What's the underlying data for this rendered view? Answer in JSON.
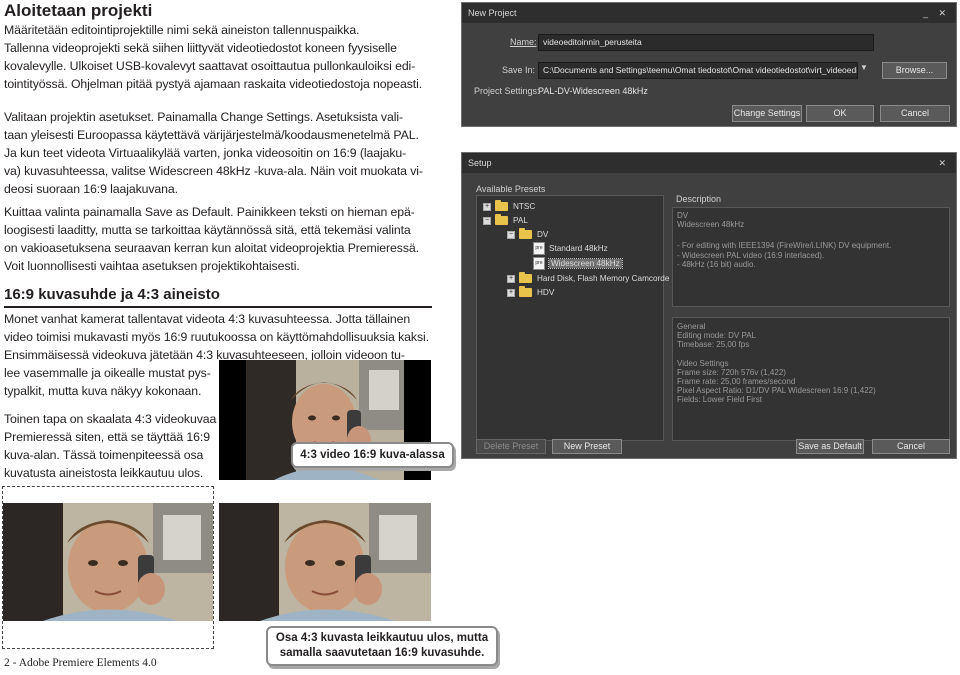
{
  "heading": "Aloitetaan projekti",
  "para1": [
    "Määritetään editointiprojektille nimi sekä aineiston tallennuspaikka.",
    "Tallenna videoprojekti sekä siihen liittyvät videotiedostot koneen fyysiselle",
    "kovalevylle. Ulkoiset USB-kovalevyt saattavat osoittautua pullonkauloiksi edi-",
    "tointityössä. Ohjelman pitää pystyä ajamaan raskaita videotiedostoja nopeasti."
  ],
  "para2": [
    "Valitaan projektin asetukset. Painamalla Change Settings. Asetuksista vali-",
    "taan yleisesti Euroopassa käytettävä värijärjestelmä/koodausmenetelmä PAL.",
    "Ja kun teet videota Virtuaalikylää varten, jonka videosoitin on 16:9 (laajaku-",
    "va) kuvasuhteessa, valitse Widescreen 48kHz -kuva-ala. Näin voit muokata vi-",
    "deosi suoraan 16:9 laajakuvana."
  ],
  "para3": [
    "Kuittaa valinta painamalla Save as Default. Painikkeen teksti on hieman epä-",
    "loogisesti laaditty, mutta se tarkoittaa käytännössä sitä, että tekemäsi valinta",
    "on vakioasetuksena seuraavan kerran kun aloitat videoprojektia Premieressä.",
    "Voit luonnollisesti vaihtaa asetuksen projektikohtaisesti."
  ],
  "subheading": "16:9 kuvasuhde ja 4:3 aineisto",
  "para4": [
    "Monet vanhat kamerat tallentavat videota 4:3 kuvasuhteessa. Jotta tällainen",
    "video toimisi mukavasti myös 16:9 ruutukoossa on käyttömahdollisuuksia kaksi.",
    "Ensimmäisessä videokuva jätetään 4:3 kuvasuhteeseen, jolloin videoon tu-",
    "lee vasemmalle ja oikealle mustat pys-",
    "typalkit, mutta kuva näkyy kokonaan."
  ],
  "para5": [
    "Toinen tapa on skaalata 4:3 videokuvaa",
    "Premieressä siten, että se täyttää 16:9",
    "kuva-alan. Tässä toimenpiteessä osa",
    "kuvatusta aineistosta leikkautuu ulos."
  ],
  "callout1": "4:3 video 16:9 kuva-alassa",
  "callout2": [
    "Osa 4:3 kuvasta leikkautuu ulos, mutta",
    "samalla saavutetaan 16:9 kuvasuhde."
  ],
  "footer": "2 - Adobe Premiere Elements 4.0",
  "new_project": {
    "title": "New Project",
    "name_label": "Name:",
    "name_value": "videoeditoinnin_perusteita",
    "save_in_label": "Save In:",
    "save_in_value": "C:\\Documents and Settings\\teemu\\Omat tiedostot\\Omat videotiedostot\\virt_videoedit...",
    "browse": "Browse...",
    "settings_label": "Project Settings:",
    "settings_value": "PAL-DV-Widescreen 48kHz",
    "change_settings": "Change Settings",
    "ok": "OK",
    "cancel": "Cancel"
  },
  "setup": {
    "title": "Setup",
    "presets_label": "Available Presets",
    "description_label": "Description",
    "tree": {
      "ntsc": "NTSC",
      "pal": "PAL",
      "dv": "DV",
      "standard": "Standard 48kHz",
      "widescreen": "Widescreen 48kHz",
      "hdd": "Hard Disk, Flash Memory Camcorde",
      "hdv": "HDV",
      "pre_icon": "pre"
    },
    "desc_top": [
      "DV",
      "Widescreen 48kHz"
    ],
    "desc_mid": [
      "- For editing with IEEE1394 (FireWire/i.LINK) DV equipment.",
      "- Widescreen PAL video (16:9 interlaced).",
      "- 48kHz (16 bit) audio."
    ],
    "desc_bottom": [
      "General",
      "  Editing mode: DV PAL",
      "  Timebase: 25,00 fps",
      "",
      "Video Settings",
      "  Frame size: 720h 576v (1,422)",
      "  Frame rate: 25,00 frames/second",
      "  Pixel Aspect Ratio: D1/DV PAL Widescreen 16:9 (1,422)",
      "  Fields: Lower Field First"
    ],
    "delete_preset": "Delete Preset",
    "new_preset": "New Preset",
    "save_default": "Save as Default",
    "cancel": "Cancel"
  },
  "colors": {
    "dialog_bg": "#404040",
    "accent": "#e8c44a"
  }
}
